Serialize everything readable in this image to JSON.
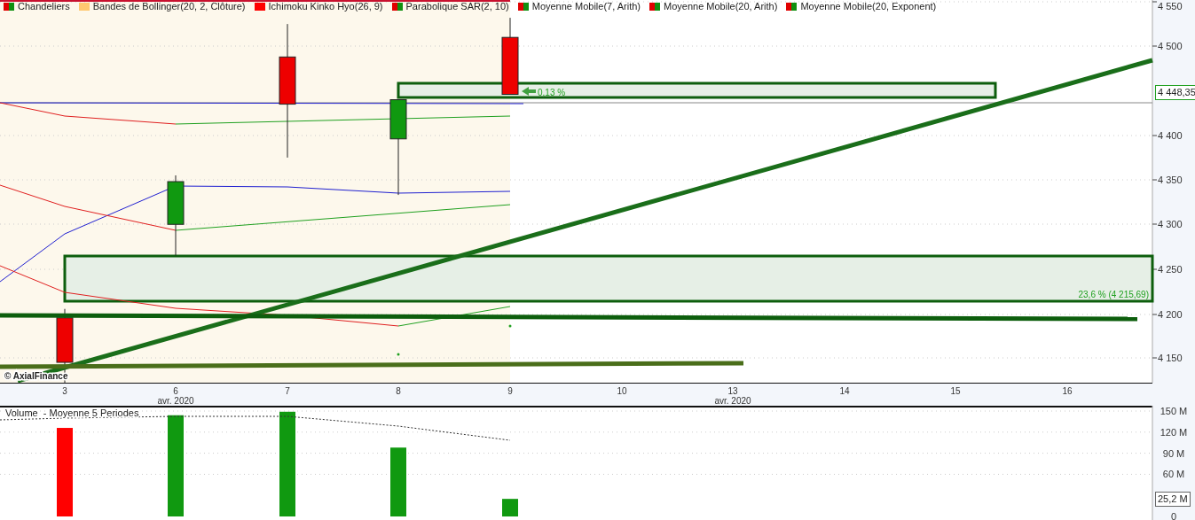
{
  "legend": [
    {
      "label": "Chandeliers",
      "swatch": [
        {
          "color": "#e00000"
        },
        {
          "color": "#109010"
        }
      ]
    },
    {
      "label": "Bandes de Bollinger(20, 2, Clôture)",
      "swatch": [
        {
          "color": "#ffc870"
        }
      ]
    },
    {
      "label": "Ichimoku Kinko Hyo(26, 9)",
      "swatch": [
        {
          "color": "#ff0000"
        }
      ]
    },
    {
      "label": "Parabolique SAR(2, 10)",
      "swatch": [
        {
          "color": "#e00000"
        },
        {
          "color": "#109010"
        }
      ]
    },
    {
      "label": "Moyenne Mobile(7, Arith)",
      "swatch": [
        {
          "color": "#e00000"
        },
        {
          "color": "#109010"
        }
      ]
    },
    {
      "label": "Moyenne Mobile(20, Arith)",
      "swatch": [
        {
          "color": "#e00000"
        },
        {
          "color": "#109010"
        }
      ]
    },
    {
      "label": "Moyenne Mobile(20, Exponent)",
      "swatch": [
        {
          "color": "#e00000"
        },
        {
          "color": "#109010"
        }
      ]
    }
  ],
  "price_chart": {
    "axis_ticks": [
      "4 550",
      "4 500",
      "4 400",
      "4 350",
      "4 300",
      "4 250",
      "4 200",
      "4 150"
    ],
    "last_price_tag": "4 448,35",
    "change_label": "0,13 %",
    "fib_label": "23,6 % (4 215,69)",
    "copyright": "© AxialFinance"
  },
  "x_axis": {
    "month_labels": [
      "avr. 2020",
      "avr. 2020"
    ]
  },
  "volume": {
    "title": "Volume  - Moyenne 5 Periodes",
    "last_value_tag": "25,2 M",
    "chart_data": {
      "type": "bar",
      "grid": true,
      "categories": [
        "3",
        "6",
        "7",
        "8",
        "9",
        "10",
        "13",
        "14",
        "15",
        "16"
      ],
      "series": [
        {
          "color": "#ff0000",
          "values": [
            126,
            null,
            null,
            null,
            null,
            null,
            null,
            null,
            null,
            null
          ]
        },
        {
          "color": "#109910",
          "values": [
            null,
            144,
            149,
            98,
            25,
            null,
            null,
            null,
            null,
            null
          ]
        }
      ],
      "ylim": [
        0,
        150
      ],
      "yticks": [
        {
          "value": 0,
          "label": "0"
        },
        {
          "value": 60,
          "label": "60 M"
        },
        {
          "value": 90,
          "label": "90 M"
        },
        {
          "value": 120,
          "label": "120 M"
        },
        {
          "value": 150,
          "label": "150 M"
        }
      ]
    }
  }
}
